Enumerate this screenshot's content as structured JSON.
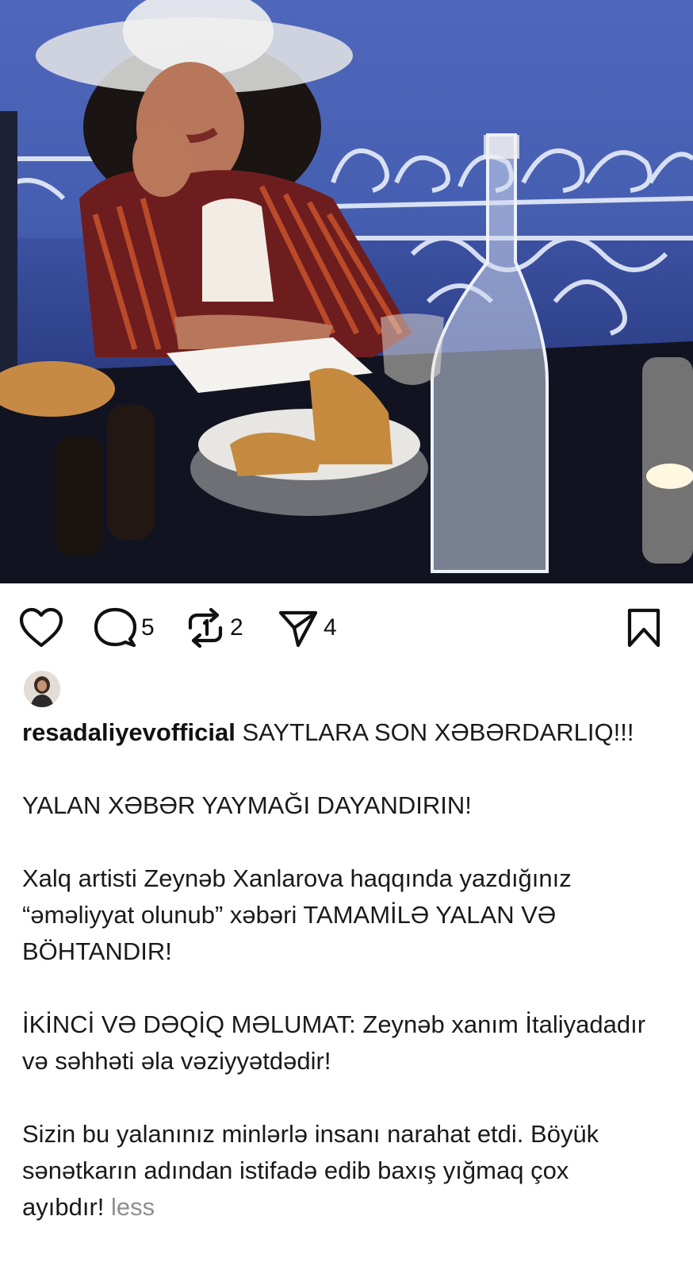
{
  "post": {
    "username": "resadaliyevofficial",
    "actions": {
      "comments_count": "5",
      "reposts_count": "2",
      "shares_count": "4"
    },
    "caption": {
      "line1": "SAYTLARA SON XƏBƏRDARLIQ!!!",
      "p2": "YALAN XƏBƏR YAYMAĞI DAYANDIRIN!",
      "p3": "Xalq artisti Zeynəb Xanlarova haqqında yazdığınız “əməliyyat olunub” xəbəri TAMAMİLƏ YALAN VƏ BÖHTANDIR!",
      "p4": "İKİNCİ VƏ DƏQİQ MƏLUMAT: Zeynəb xanım İtaliyadadır və səhhəti əla vəziyyətdədir!",
      "p5": "Sizin bu yalanınız minlərlə insanı narahat etdi. Böyük sənətkarın adından istifadə edib baxış yığmaq çox ayıbdır!",
      "less_label": "less"
    }
  },
  "colors": {
    "icon": "#111111",
    "muted": "#8e8e8e",
    "photo_sky": "#4d64b8"
  }
}
